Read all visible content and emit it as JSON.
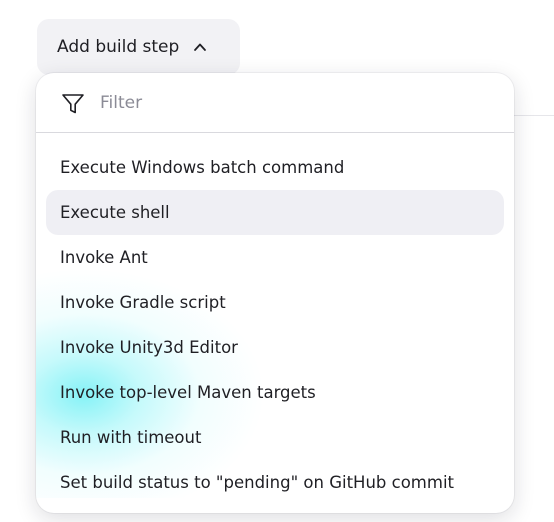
{
  "button": {
    "label": "Add build step",
    "icon": "chevron-up-icon"
  },
  "filter": {
    "placeholder": "Filter",
    "value": "",
    "icon": "funnel-icon"
  },
  "menu": {
    "items": [
      {
        "label": "Execute Windows batch command",
        "highlighted": false
      },
      {
        "label": "Execute shell",
        "highlighted": true
      },
      {
        "label": "Invoke Ant",
        "highlighted": false
      },
      {
        "label": "Invoke Gradle script",
        "highlighted": false
      },
      {
        "label": "Invoke Unity3d Editor",
        "highlighted": false
      },
      {
        "label": "Invoke top-level Maven targets",
        "highlighted": false
      },
      {
        "label": "Run with timeout",
        "highlighted": false
      },
      {
        "label": "Set build status to \"pending\" on GitHub commit",
        "highlighted": false
      }
    ]
  },
  "colors": {
    "highlight": "#efeff4",
    "button_bg": "#f2f2f5",
    "text": "#1f1f24",
    "placeholder": "#8b8b96",
    "cursor_glow": "#70f0f5"
  }
}
